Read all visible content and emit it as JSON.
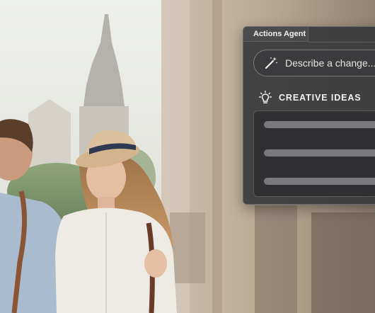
{
  "panel": {
    "tab_label": "Actions Agent",
    "prompt": {
      "placeholder": "Describe a change...",
      "icon": "magic-wand-icon"
    },
    "ideas": {
      "heading": "CREATIVE IDEAS",
      "icon": "lightbulb-icon",
      "suggestions": [
        "",
        "",
        ""
      ]
    }
  },
  "colors": {
    "panel_background": "#3a3a3c",
    "panel_border": "#6a6a6c",
    "text": "#f2f2f2",
    "placeholder_bar": "#7a7a7c"
  }
}
